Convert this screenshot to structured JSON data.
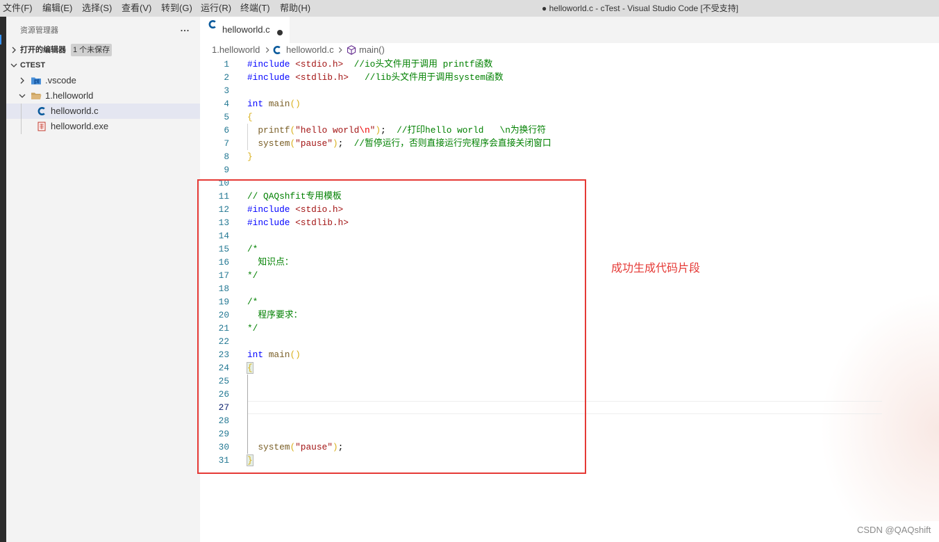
{
  "window": {
    "title": "● helloworld.c - cTest - Visual Studio Code [不受支持]"
  },
  "menu": {
    "items": [
      "文件(F)",
      "编辑(E)",
      "选择(S)",
      "查看(V)",
      "转到(G)",
      "运行(R)",
      "终端(T)",
      "帮助(H)"
    ]
  },
  "sidebar": {
    "title": "资源管理器",
    "more_icon": "more-actions-icon",
    "open_editors": {
      "label": "打开的编辑器",
      "badge": "1 个未保存",
      "expanded": false
    },
    "workspace": {
      "label": "CTEST",
      "expanded": true
    },
    "tree": [
      {
        "label": ".vscode",
        "icon": "vscode-folder-icon",
        "expanded": false
      },
      {
        "label": "1.helloworld",
        "icon": "folder-open-icon",
        "expanded": true
      },
      {
        "label": "helloworld.c",
        "icon": "c-file-icon",
        "selected": true
      },
      {
        "label": "helloworld.exe",
        "icon": "exe-file-icon",
        "selected": false
      }
    ]
  },
  "tabs": [
    {
      "label": "helloworld.c",
      "icon": "c-file-icon",
      "active": true,
      "unsaved": true
    }
  ],
  "breadcrumb": [
    {
      "label": "1.helloworld"
    },
    {
      "label": "helloworld.c",
      "icon": "c-file-icon"
    },
    {
      "label": "main()",
      "icon": "symbol-method-icon"
    }
  ],
  "editor": {
    "cursor_line": 27,
    "lines": [
      {
        "n": 1,
        "tokens": [
          {
            "t": "#include",
            "c": "#0000ff"
          },
          {
            "t": " ",
            "c": "#000000"
          },
          {
            "t": "<stdio.h>",
            "c": "#a31515"
          },
          {
            "t": "  ",
            "c": "#000000"
          },
          {
            "t": "//io头文件用于调用 printf函数",
            "c": "#008000"
          }
        ]
      },
      {
        "n": 2,
        "tokens": [
          {
            "t": "#include",
            "c": "#0000ff"
          },
          {
            "t": " ",
            "c": "#000000"
          },
          {
            "t": "<stdlib.h>",
            "c": "#a31515"
          },
          {
            "t": "   ",
            "c": "#000000"
          },
          {
            "t": "//lib头文件用于调用system函数",
            "c": "#008000"
          }
        ]
      },
      {
        "n": 3,
        "tokens": []
      },
      {
        "n": 4,
        "tokens": [
          {
            "t": "int",
            "c": "#0000ff"
          },
          {
            "t": " ",
            "c": "#000000"
          },
          {
            "t": "main",
            "c": "#795e26"
          },
          {
            "t": "()",
            "c": "#d9b01c"
          }
        ]
      },
      {
        "n": 5,
        "tokens": [
          {
            "t": "{",
            "c": "#d9b01c"
          }
        ]
      },
      {
        "n": 6,
        "tokens": [
          {
            "t": "  ",
            "c": "#000000"
          },
          {
            "t": "printf",
            "c": "#795e26"
          },
          {
            "t": "(",
            "c": "#d9b01c"
          },
          {
            "t": "\"hello world",
            "c": "#a31515"
          },
          {
            "t": "\\n",
            "c": "#ee0000"
          },
          {
            "t": "\"",
            "c": "#a31515"
          },
          {
            "t": ")",
            "c": "#d9b01c"
          },
          {
            "t": ";",
            "c": "#000000"
          },
          {
            "t": "  ",
            "c": "#000000"
          },
          {
            "t": "//打印hello world   \\n为换行符",
            "c": "#008000"
          }
        ]
      },
      {
        "n": 7,
        "tokens": [
          {
            "t": "  ",
            "c": "#000000"
          },
          {
            "t": "system",
            "c": "#795e26"
          },
          {
            "t": "(",
            "c": "#d9b01c"
          },
          {
            "t": "\"pause\"",
            "c": "#a31515"
          },
          {
            "t": ")",
            "c": "#d9b01c"
          },
          {
            "t": ";",
            "c": "#000000"
          },
          {
            "t": "  ",
            "c": "#000000"
          },
          {
            "t": "//暂停运行，否则直接运行完程序会直接关闭窗口",
            "c": "#008000"
          }
        ]
      },
      {
        "n": 8,
        "tokens": [
          {
            "t": "}",
            "c": "#d9b01c"
          }
        ]
      },
      {
        "n": 9,
        "tokens": []
      },
      {
        "n": 10,
        "tokens": []
      },
      {
        "n": 11,
        "tokens": [
          {
            "t": "// QAQshfit专用模板",
            "c": "#008000"
          }
        ]
      },
      {
        "n": 12,
        "tokens": [
          {
            "t": "#include",
            "c": "#0000ff"
          },
          {
            "t": " ",
            "c": "#000000"
          },
          {
            "t": "<stdio.h>",
            "c": "#a31515"
          }
        ]
      },
      {
        "n": 13,
        "tokens": [
          {
            "t": "#include",
            "c": "#0000ff"
          },
          {
            "t": " ",
            "c": "#000000"
          },
          {
            "t": "<stdlib.h>",
            "c": "#a31515"
          }
        ]
      },
      {
        "n": 14,
        "tokens": []
      },
      {
        "n": 15,
        "tokens": [
          {
            "t": "/*",
            "c": "#008000"
          }
        ]
      },
      {
        "n": 16,
        "tokens": [
          {
            "t": "  知识点：",
            "c": "#008000"
          }
        ]
      },
      {
        "n": 17,
        "tokens": [
          {
            "t": "*/",
            "c": "#008000"
          }
        ]
      },
      {
        "n": 18,
        "tokens": []
      },
      {
        "n": 19,
        "tokens": [
          {
            "t": "/*",
            "c": "#008000"
          }
        ]
      },
      {
        "n": 20,
        "tokens": [
          {
            "t": "  程序要求：",
            "c": "#008000"
          }
        ]
      },
      {
        "n": 21,
        "tokens": [
          {
            "t": "*/",
            "c": "#008000"
          }
        ]
      },
      {
        "n": 22,
        "tokens": []
      },
      {
        "n": 23,
        "tokens": [
          {
            "t": "int",
            "c": "#0000ff"
          },
          {
            "t": " ",
            "c": "#000000"
          },
          {
            "t": "main",
            "c": "#795e26"
          },
          {
            "t": "()",
            "c": "#d9b01c"
          }
        ]
      },
      {
        "n": 24,
        "tokens": [
          {
            "t": "{",
            "c": "#d9b01c"
          }
        ]
      },
      {
        "n": 25,
        "tokens": []
      },
      {
        "n": 26,
        "tokens": []
      },
      {
        "n": 27,
        "tokens": []
      },
      {
        "n": 28,
        "tokens": []
      },
      {
        "n": 29,
        "tokens": []
      },
      {
        "n": 30,
        "tokens": [
          {
            "t": "  ",
            "c": "#000000"
          },
          {
            "t": "system",
            "c": "#795e26"
          },
          {
            "t": "(",
            "c": "#d9b01c"
          },
          {
            "t": "\"pause\"",
            "c": "#a31515"
          },
          {
            "t": ")",
            "c": "#d9b01c"
          },
          {
            "t": ";",
            "c": "#000000"
          }
        ]
      },
      {
        "n": 31,
        "tokens": [
          {
            "t": "}",
            "c": "#d9b01c"
          }
        ]
      }
    ]
  },
  "annotation": {
    "text": "成功生成代码片段"
  },
  "watermark": "CSDN @QAQshift",
  "colors": {
    "annotation": "#e53935",
    "line_number": "#237893",
    "line_number_active": "#0b216f",
    "selection": "#e4e6f1",
    "menubar": "#dddddd",
    "sidebar": "#f3f3f3"
  }
}
